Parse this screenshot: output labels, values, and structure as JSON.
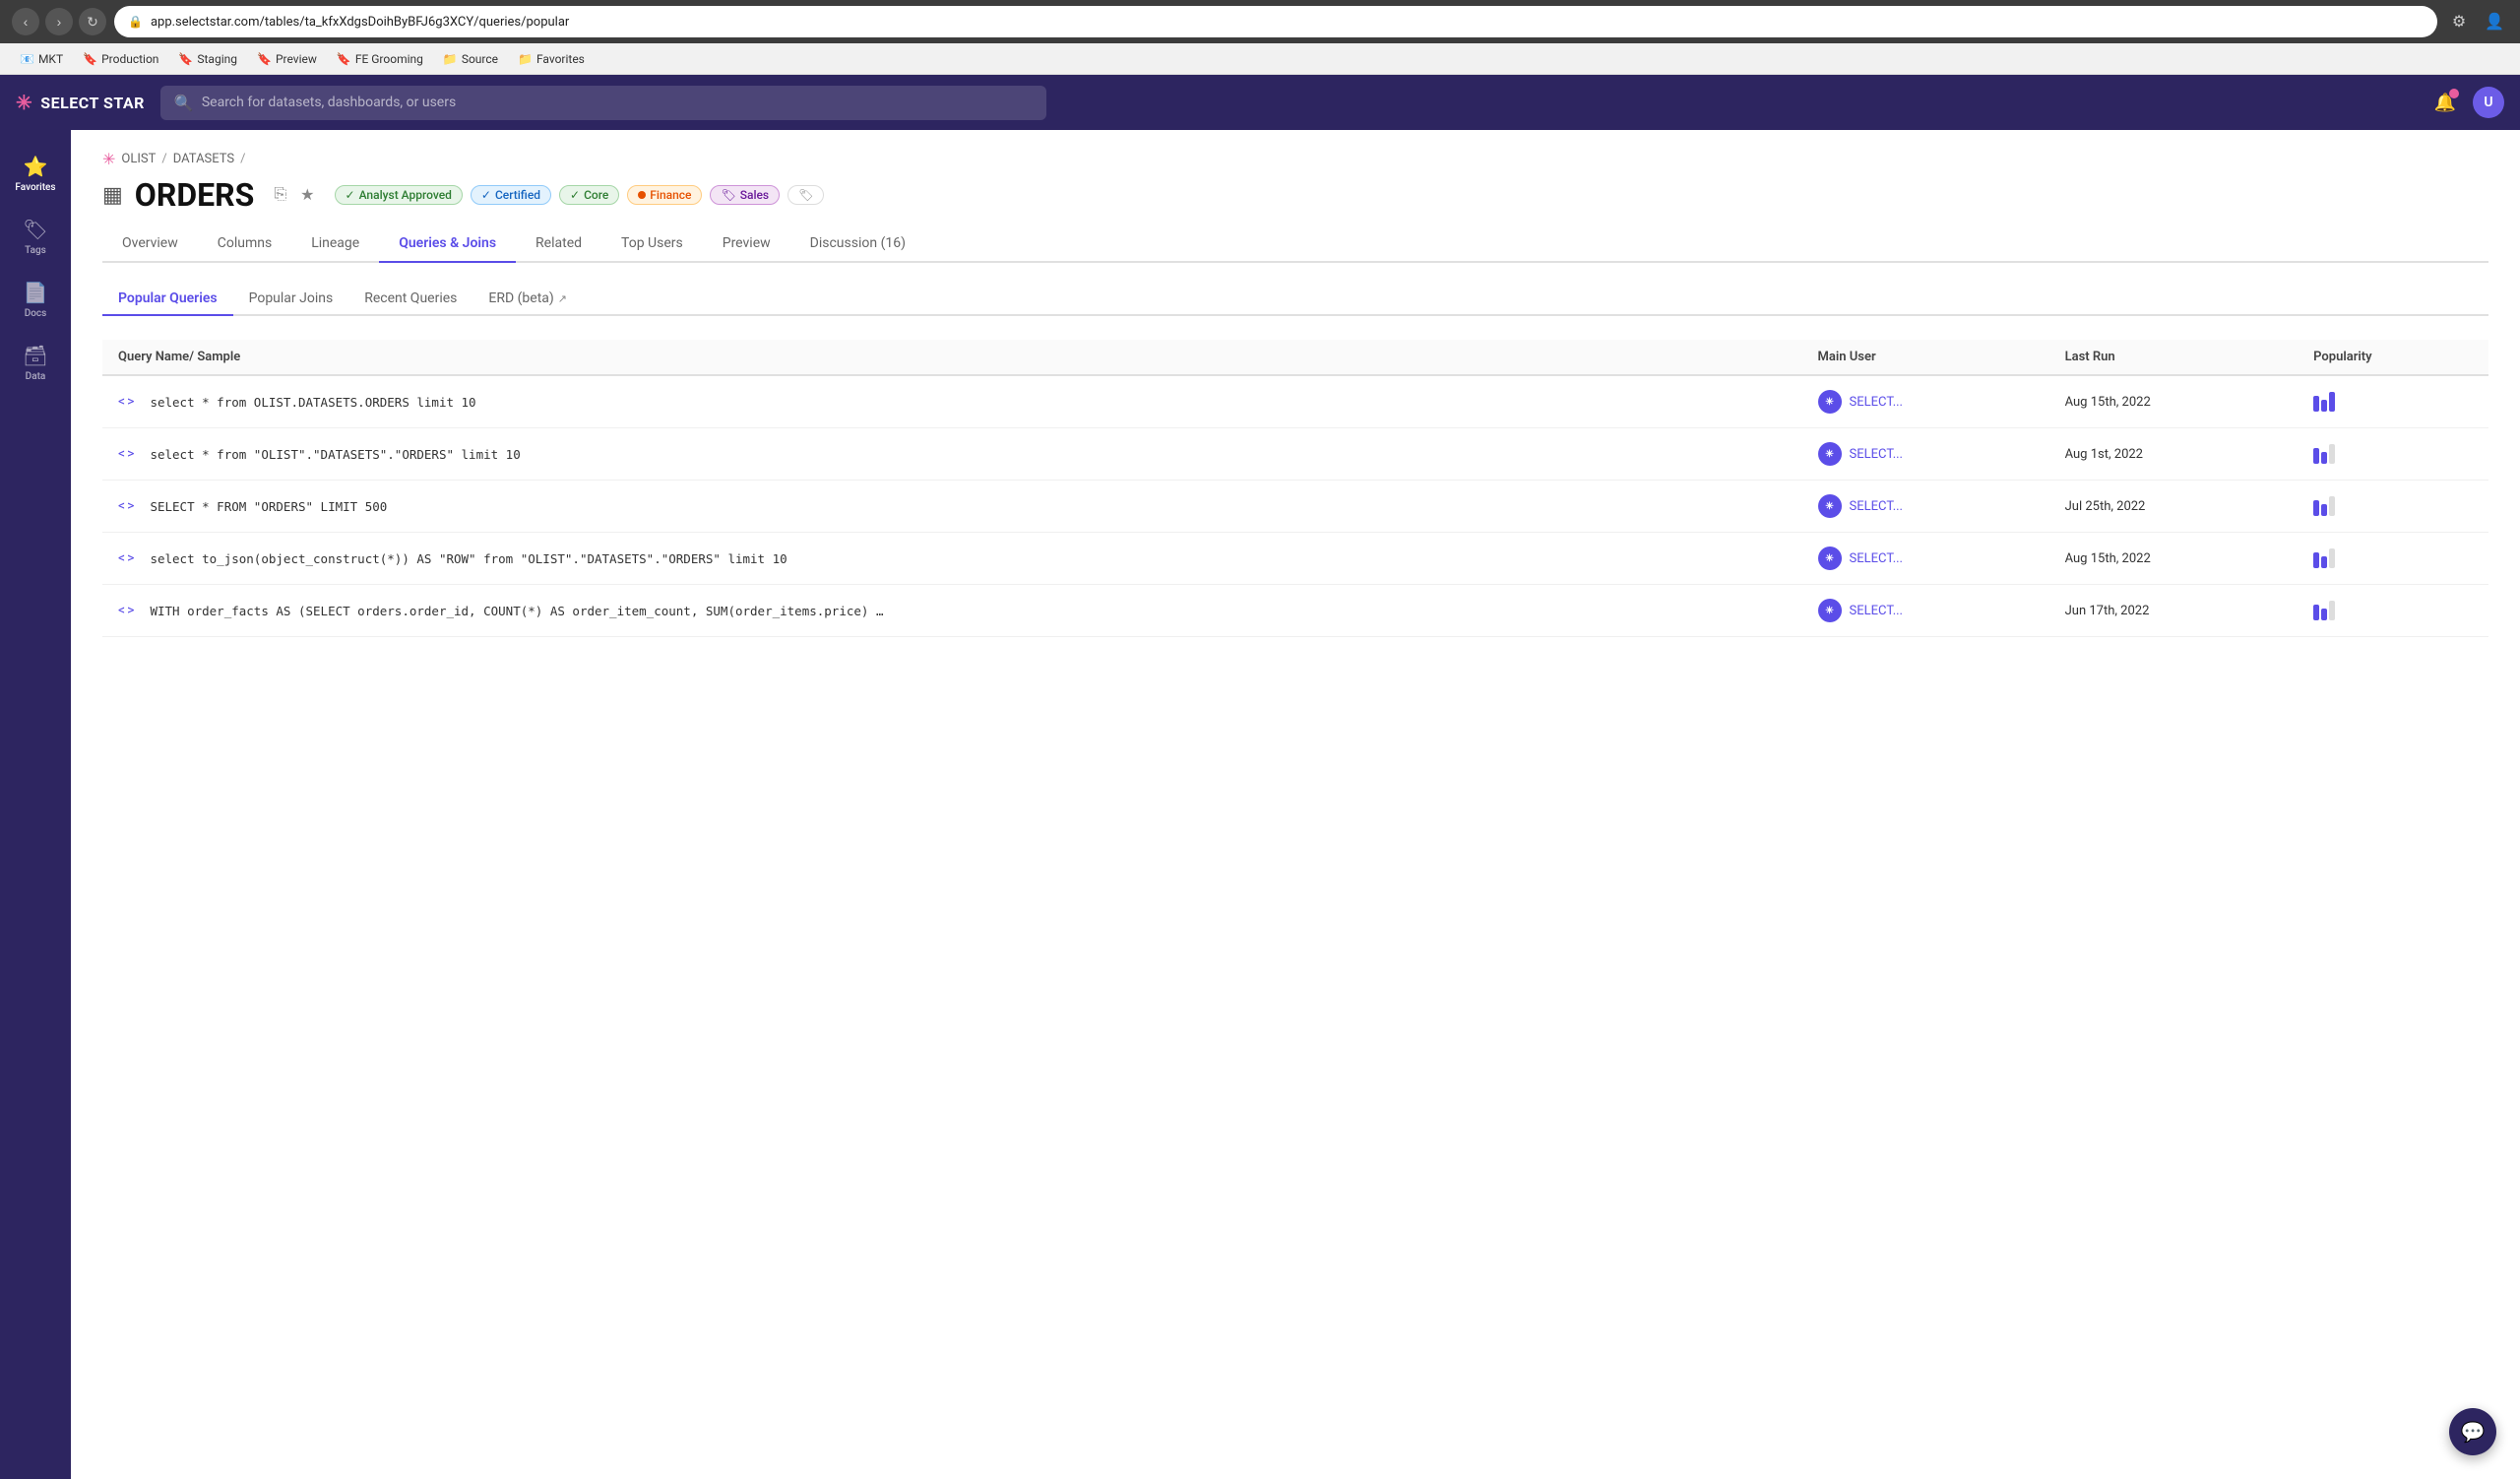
{
  "browser": {
    "url": "app.selectstar.com/tables/ta_kfxXdgsDoihByBFJ6g3XCY/queries/popular",
    "bookmarks": [
      {
        "label": "MKT",
        "icon": "📧"
      },
      {
        "label": "Production",
        "icon": "🔖"
      },
      {
        "label": "Staging",
        "icon": "🔖"
      },
      {
        "label": "Preview",
        "icon": "🔖"
      },
      {
        "label": "FE Grooming",
        "icon": "🔖"
      },
      {
        "label": "Source",
        "icon": "📁"
      },
      {
        "label": "Favorites",
        "icon": "📁"
      }
    ]
  },
  "header": {
    "logo_text": "SELECT STAR",
    "search_placeholder": "Search for datasets, dashboards, or users"
  },
  "sidebar": {
    "items": [
      {
        "label": "Favorites",
        "icon": "⭐"
      },
      {
        "label": "Tags",
        "icon": "🏷"
      },
      {
        "label": "Docs",
        "icon": "📄"
      },
      {
        "label": "Data",
        "icon": "🗃"
      }
    ]
  },
  "breadcrumb": {
    "items": [
      "OLIST",
      "DATASETS"
    ]
  },
  "page": {
    "title": "ORDERS",
    "badges": [
      {
        "label": "Analyst Approved",
        "type": "analyst"
      },
      {
        "label": "Certified",
        "type": "certified"
      },
      {
        "label": "Core",
        "type": "core"
      },
      {
        "label": "Finance",
        "type": "finance"
      },
      {
        "label": "Sales",
        "type": "sales"
      }
    ]
  },
  "nav_tabs": [
    {
      "label": "Overview",
      "active": false
    },
    {
      "label": "Columns",
      "active": false
    },
    {
      "label": "Lineage",
      "active": false
    },
    {
      "label": "Queries & Joins",
      "active": true
    },
    {
      "label": "Related",
      "active": false
    },
    {
      "label": "Top Users",
      "active": false
    },
    {
      "label": "Preview",
      "active": false
    },
    {
      "label": "Discussion (16)",
      "active": false
    }
  ],
  "sub_tabs": [
    {
      "label": "Popular Queries",
      "active": true
    },
    {
      "label": "Popular Joins",
      "active": false
    },
    {
      "label": "Recent Queries",
      "active": false
    },
    {
      "label": "ERD (beta)",
      "active": false,
      "external": true
    }
  ],
  "table": {
    "columns": [
      {
        "label": "Query Name/ Sample"
      },
      {
        "label": "Main User"
      },
      {
        "label": "Last Run"
      },
      {
        "label": "Popularity"
      }
    ],
    "rows": [
      {
        "query": "select * from OLIST.DATASETS.ORDERS limit 10",
        "user": "SELECT...",
        "last_run": "Aug 15th, 2022",
        "popularity": 3,
        "max_popularity": 3
      },
      {
        "query": "select * from \"OLIST\".\"DATASETS\".\"ORDERS\" limit 10",
        "user": "SELECT...",
        "last_run": "Aug 1st, 2022",
        "popularity": 2,
        "max_popularity": 3
      },
      {
        "query": "SELECT * FROM \"ORDERS\" LIMIT 500",
        "user": "SELECT...",
        "last_run": "Jul 25th, 2022",
        "popularity": 2,
        "max_popularity": 3
      },
      {
        "query": "select to_json(object_construct(*)) AS \"ROW\" from \"OLIST\".\"DATASETS\".\"ORDERS\" limit 10",
        "user": "SELECT...",
        "last_run": "Aug 15th, 2022",
        "popularity": 2,
        "max_popularity": 3
      },
      {
        "query": "WITH order_facts AS (SELECT orders.order_id, COUNT(*) AS order_item_count, SUM(order_items.price) AS price, SUM(order_items.freight_value) AS freig...",
        "user": "SELECT...",
        "last_run": "Jun 17th, 2022",
        "popularity": 2,
        "max_popularity": 3
      }
    ]
  },
  "chat_button": {
    "icon": "💬"
  }
}
